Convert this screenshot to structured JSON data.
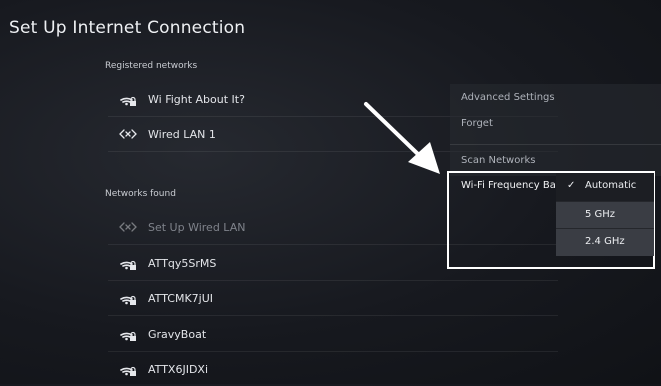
{
  "page": {
    "title": "Set Up Internet Connection"
  },
  "registered": {
    "heading": "Registered networks",
    "items": [
      {
        "label": "Wi Fight About It?",
        "icon": "wifi-lock-icon"
      },
      {
        "label": "Wired LAN 1",
        "icon": "wired-lan-icon"
      }
    ]
  },
  "found": {
    "heading": "Networks found",
    "items": [
      {
        "label": "Set Up Wired LAN",
        "icon": "wired-lan-icon"
      },
      {
        "label": "ATTqy5SrMS",
        "icon": "wifi-lock-icon"
      },
      {
        "label": "ATTCMK7jUI",
        "icon": "wifi-lock-icon"
      },
      {
        "label": "GravyBoat",
        "icon": "wifi-lock-icon"
      },
      {
        "label": "ATTX6JIDXi",
        "icon": "wifi-lock-icon"
      }
    ]
  },
  "options_menu": {
    "advanced": "Advanced Settings",
    "forget": "Forget",
    "scan": "Scan Networks",
    "band_label": "Wi-Fi Frequency Ba",
    "band_options": [
      "Automatic",
      "5 GHz",
      "2.4 GHz"
    ],
    "band_selected": "Automatic"
  },
  "colors": {
    "highlight_border": "#ffffff",
    "arrow": "#ffffff"
  }
}
